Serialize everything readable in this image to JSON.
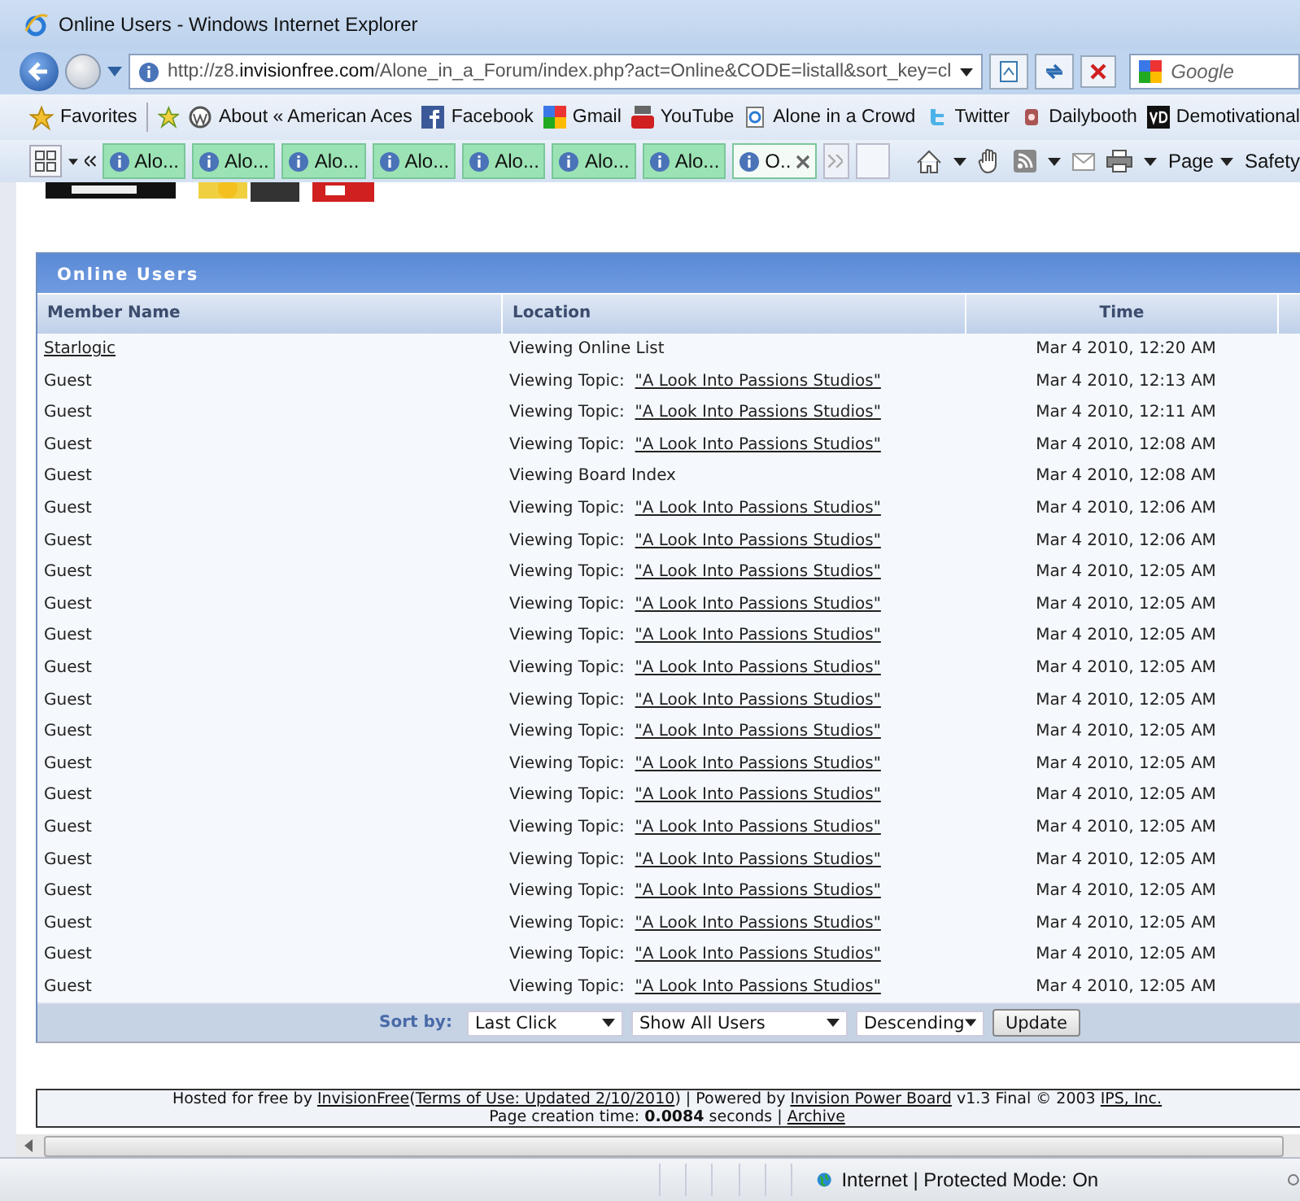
{
  "window": {
    "title": "Online Users - Windows Internet Explorer"
  },
  "address_bar": {
    "url_prefix": "http://z8.",
    "url_domain": "invisionfree.com",
    "url_rest": "/Alone_in_a_Forum/index.php?act=Online&CODE=listall&sort_key=cl"
  },
  "search": {
    "placeholder": "Google"
  },
  "favorites_bar": {
    "favorites": "Favorites",
    "items": [
      {
        "label": "About « American Aces"
      },
      {
        "label": "Facebook"
      },
      {
        "label": "Gmail"
      },
      {
        "label": "YouTube"
      },
      {
        "label": "Alone in a Crowd"
      },
      {
        "label": "Twitter"
      },
      {
        "label": "Dailybooth"
      },
      {
        "label": "Demotivational"
      }
    ]
  },
  "tabs": [
    {
      "label": "Alo...",
      "selected": false
    },
    {
      "label": "Alo...",
      "selected": false
    },
    {
      "label": "Alo...",
      "selected": false
    },
    {
      "label": "Alo...",
      "selected": false
    },
    {
      "label": "Alo...",
      "selected": false
    },
    {
      "label": "Alo...",
      "selected": false
    },
    {
      "label": "Alo...",
      "selected": false
    },
    {
      "label": "O..",
      "selected": true
    }
  ],
  "command_bar": {
    "page": "Page",
    "safety": "Safety"
  },
  "table": {
    "title": "Online Users",
    "columns": [
      "Member Name",
      "Location",
      "Time"
    ],
    "rows": [
      {
        "member": "Starlogic",
        "kind": "link",
        "location": "Viewing Online List",
        "time": "Mar 4 2010, 12:20 AM"
      },
      {
        "member": "Guest",
        "kind": "plain",
        "location": "Viewing Topic:",
        "topic": "\"A Look Into Passions Studios\"",
        "time": "Mar 4 2010, 12:13 AM"
      },
      {
        "member": "Guest",
        "kind": "plain",
        "location": "Viewing Topic:",
        "topic": "\"A Look Into Passions Studios\"",
        "time": "Mar 4 2010, 12:11 AM"
      },
      {
        "member": "Guest",
        "kind": "plain",
        "location": "Viewing Topic:",
        "topic": "\"A Look Into Passions Studios\"",
        "time": "Mar 4 2010, 12:08 AM"
      },
      {
        "member": "Guest",
        "kind": "plain",
        "location": "Viewing Board Index",
        "time": "Mar 4 2010, 12:08 AM"
      },
      {
        "member": "Guest",
        "kind": "plain",
        "location": "Viewing Topic:",
        "topic": "\"A Look Into Passions Studios\"",
        "time": "Mar 4 2010, 12:06 AM"
      },
      {
        "member": "Guest",
        "kind": "plain",
        "location": "Viewing Topic:",
        "topic": "\"A Look Into Passions Studios\"",
        "time": "Mar 4 2010, 12:06 AM"
      },
      {
        "member": "Guest",
        "kind": "plain",
        "location": "Viewing Topic:",
        "topic": "\"A Look Into Passions Studios\"",
        "time": "Mar 4 2010, 12:05 AM"
      },
      {
        "member": "Guest",
        "kind": "plain",
        "location": "Viewing Topic:",
        "topic": "\"A Look Into Passions Studios\"",
        "time": "Mar 4 2010, 12:05 AM"
      },
      {
        "member": "Guest",
        "kind": "plain",
        "location": "Viewing Topic:",
        "topic": "\"A Look Into Passions Studios\"",
        "time": "Mar 4 2010, 12:05 AM"
      },
      {
        "member": "Guest",
        "kind": "plain",
        "location": "Viewing Topic:",
        "topic": "\"A Look Into Passions Studios\"",
        "time": "Mar 4 2010, 12:05 AM"
      },
      {
        "member": "Guest",
        "kind": "plain",
        "location": "Viewing Topic:",
        "topic": "\"A Look Into Passions Studios\"",
        "time": "Mar 4 2010, 12:05 AM"
      },
      {
        "member": "Guest",
        "kind": "plain",
        "location": "Viewing Topic:",
        "topic": "\"A Look Into Passions Studios\"",
        "time": "Mar 4 2010, 12:05 AM"
      },
      {
        "member": "Guest",
        "kind": "plain",
        "location": "Viewing Topic:",
        "topic": "\"A Look Into Passions Studios\"",
        "time": "Mar 4 2010, 12:05 AM"
      },
      {
        "member": "Guest",
        "kind": "plain",
        "location": "Viewing Topic:",
        "topic": "\"A Look Into Passions Studios\"",
        "time": "Mar 4 2010, 12:05 AM"
      },
      {
        "member": "Guest",
        "kind": "plain",
        "location": "Viewing Topic:",
        "topic": "\"A Look Into Passions Studios\"",
        "time": "Mar 4 2010, 12:05 AM"
      },
      {
        "member": "Guest",
        "kind": "plain",
        "location": "Viewing Topic:",
        "topic": "\"A Look Into Passions Studios\"",
        "time": "Mar 4 2010, 12:05 AM"
      },
      {
        "member": "Guest",
        "kind": "plain",
        "location": "Viewing Topic:",
        "topic": "\"A Look Into Passions Studios\"",
        "time": "Mar 4 2010, 12:05 AM"
      },
      {
        "member": "Guest",
        "kind": "plain",
        "location": "Viewing Topic:",
        "topic": "\"A Look Into Passions Studios\"",
        "time": "Mar 4 2010, 12:05 AM"
      },
      {
        "member": "Guest",
        "kind": "plain",
        "location": "Viewing Topic:",
        "topic": "\"A Look Into Passions Studios\"",
        "time": "Mar 4 2010, 12:05 AM"
      },
      {
        "member": "Guest",
        "kind": "plain",
        "location": "Viewing Topic:",
        "topic": "\"A Look Into Passions Studios\"",
        "time": "Mar 4 2010, 12:05 AM"
      }
    ]
  },
  "sort_bar": {
    "label": "Sort by:",
    "selects": [
      "Last Click",
      "Show All Users",
      "Descending"
    ],
    "button": "Update"
  },
  "footer": {
    "lines": [
      [
        {
          "kind": "text",
          "text": "Hosted for free by"
        },
        {
          "kind": "link",
          "text": "InvisionFree"
        },
        {
          "kind": "text",
          "text": "("
        },
        {
          "kind": "link",
          "text": "Terms of Use: Updated 2/10/2010"
        },
        {
          "kind": "text",
          "text": ") | Powered by"
        },
        {
          "kind": "link",
          "text": "Invision Power Board"
        },
        {
          "kind": "text",
          "text": "v1.3 Final © 2003"
        },
        {
          "kind": "link",
          "text": "IPS, Inc."
        }
      ],
      [
        {
          "kind": "text",
          "text": "Page creation time: **0.0084** seconds |"
        },
        {
          "kind": "link",
          "text": "Archive"
        }
      ]
    ]
  },
  "status_bar": {
    "zone": "Internet | Protected Mode: On"
  }
}
